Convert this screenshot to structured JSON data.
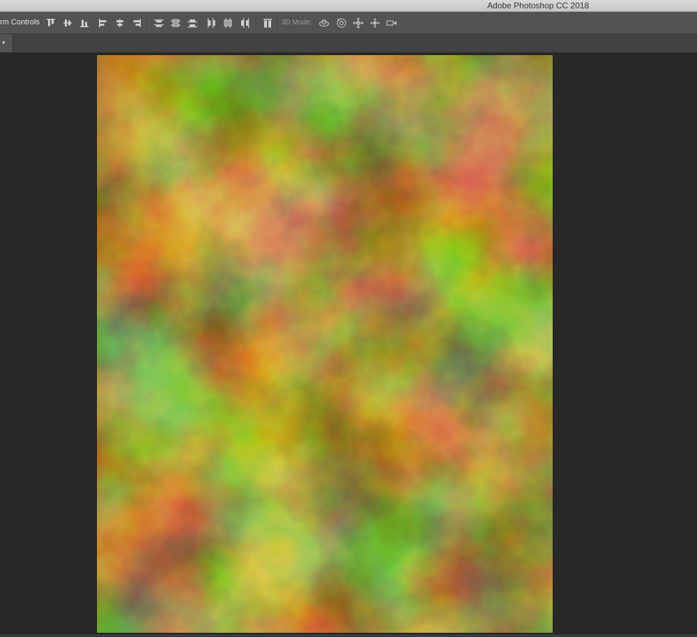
{
  "window": {
    "title": "Adobe Photoshop CC 2018"
  },
  "options_bar": {
    "transform_label": "rm Controls",
    "mode3d_label": "3D Mode:",
    "align_icons": [
      "align-top-edges-icon",
      "align-vertical-centers-icon",
      "align-bottom-edges-icon",
      "align-left-edges-icon",
      "align-horizontal-centers-icon",
      "align-right-edges-icon"
    ],
    "distribute_icons": [
      "distribute-top-edges-icon",
      "distribute-vertical-centers-icon",
      "distribute-bottom-edges-icon",
      "distribute-left-edges-icon",
      "distribute-horizontal-centers-icon",
      "distribute-right-edges-icon"
    ],
    "auto_align_icon": "auto-align-layers-icon",
    "mode3d_icons": [
      "orbit-3d-icon",
      "roll-3d-icon",
      "drag-3d-icon",
      "slide-3d-icon",
      "scale-3d-icon"
    ]
  },
  "tabs": {
    "active_tab_marker": "•"
  },
  "canvas": {
    "fill": "clouds",
    "base_color": "#a89a3a",
    "light_color": "#d8c858",
    "dark_color": "#6e6218"
  },
  "colors": {
    "workspace": "#282828",
    "options_bar": "#535353",
    "tab_bar": "#424242",
    "title_bar": "#d0d0d0"
  }
}
